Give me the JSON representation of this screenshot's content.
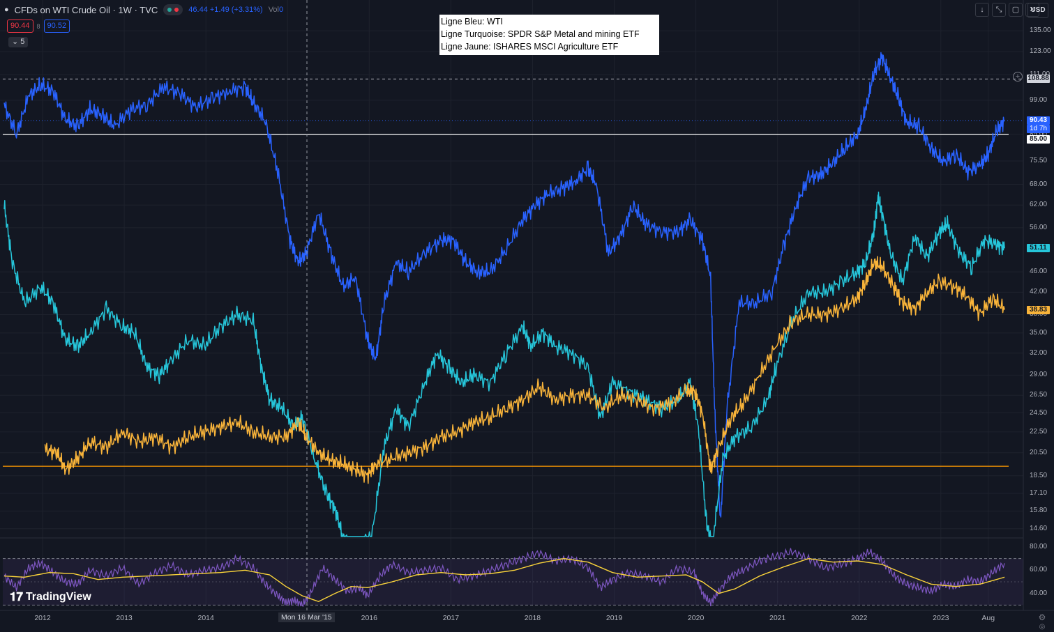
{
  "header": {
    "title": "CFDs on WTI Crude Oil · 1W · TVC",
    "stats": "46.44 +1.49 (+3.31%)",
    "vol_label": "Vol",
    "vol_value": "0",
    "price_left": "90.44",
    "price_mid": "8",
    "price_right": "90.52",
    "collapse_count": "5",
    "currency": "USD"
  },
  "toolbar_icons": [
    "arrow-down-icon",
    "collapse-icon",
    "restore-icon",
    "close-icon"
  ],
  "annotation": {
    "lines": [
      "Ligne Bleu: WTI",
      "Ligne Turquoise: SPDR S&P Metal and mining ETF",
      "Ligne Jaune: ISHARES MSCI Agriculture ETF"
    ]
  },
  "watermark": "TradingView",
  "crosshair_label": "Mon 16 Mar '15",
  "colors": {
    "background": "#131722",
    "wti": "#2962ff",
    "metal": "#26c6da",
    "agri": "#f9b43a",
    "rsi": "#7e57c2",
    "rsi_ma": "#f9d33a",
    "hline_orange": "#ff9800",
    "hline_white": "#ffffff"
  },
  "chart_data": [
    {
      "type": "line",
      "scale": "log",
      "x_ticks": [
        "2012",
        "2013",
        "2014",
        "2015",
        "2016",
        "2017",
        "2018",
        "2019",
        "2020",
        "2021",
        "2022",
        "2023",
        "Aug"
      ],
      "y_ticks": [
        "135.00",
        "123.00",
        "111.00",
        "99.00",
        "85.00",
        "75.50",
        "68.00",
        "62.00",
        "56.00",
        "46.00",
        "42.00",
        "38.00",
        "35.00",
        "32.00",
        "29.00",
        "26.50",
        "24.50",
        "22.50",
        "20.50",
        "18.50",
        "17.10",
        "15.80",
        "14.60"
      ],
      "ylim": [
        14.1,
        142
      ],
      "xlim": [
        2011.55,
        2023.85
      ],
      "horizontal_lines": [
        {
          "value": 108.88,
          "label": "108.88",
          "style": "dashed",
          "color": "#b2b5be"
        },
        {
          "value": 85.0,
          "label": "85.00",
          "style": "solid",
          "color": "#ffffff"
        },
        {
          "value": 19.3,
          "label": "",
          "style": "solid",
          "color": "#ff9800"
        }
      ],
      "last_values": [
        {
          "series": "WTI",
          "value": "90.43",
          "countdown": "1d 7h"
        },
        {
          "series": "Metal",
          "value": "51.11"
        },
        {
          "series": "Agri",
          "value": "38.83"
        }
      ],
      "series": [
        {
          "name": "WTI",
          "x": [
            2011.55,
            2011.7,
            2011.85,
            2012.0,
            2012.15,
            2012.3,
            2012.45,
            2012.6,
            2012.75,
            2012.9,
            2013.1,
            2013.3,
            2013.5,
            2013.7,
            2013.9,
            2014.1,
            2014.3,
            2014.5,
            2014.6,
            2014.75,
            2014.9,
            2015.05,
            2015.15,
            2015.25,
            2015.4,
            2015.55,
            2015.7,
            2015.85,
            2016.0,
            2016.1,
            2016.2,
            2016.35,
            2016.5,
            2016.7,
            2016.9,
            2017.05,
            2017.2,
            2017.35,
            2017.5,
            2017.7,
            2017.9,
            2018.05,
            2018.2,
            2018.4,
            2018.55,
            2018.7,
            2018.8,
            2018.95,
            2019.1,
            2019.25,
            2019.4,
            2019.6,
            2019.8,
            2019.95,
            2020.1,
            2020.2,
            2020.25,
            2020.32,
            2020.4,
            2020.55,
            2020.75,
            2020.95,
            2021.1,
            2021.25,
            2021.4,
            2021.55,
            2021.7,
            2021.85,
            2022.0,
            2022.1,
            2022.2,
            2022.3,
            2022.4,
            2022.5,
            2022.6,
            2022.75,
            2022.9,
            2023.05,
            2023.2,
            2023.35,
            2023.5,
            2023.6,
            2023.7,
            2023.8
          ],
          "values": [
            97,
            85,
            101,
            106,
            103,
            91,
            88,
            95,
            93,
            88,
            95,
            97,
            105,
            102,
            96,
            100,
            103,
            105,
            98,
            90,
            72,
            53,
            48,
            50,
            60,
            50,
            43,
            45,
            34,
            31,
            40,
            48,
            46,
            50,
            53,
            53,
            48,
            46,
            46,
            51,
            58,
            62,
            65,
            67,
            69,
            73,
            68,
            50,
            54,
            62,
            57,
            55,
            55,
            58,
            53,
            45,
            25,
            15,
            25,
            40,
            40,
            42,
            52,
            62,
            70,
            71,
            75,
            80,
            85,
            95,
            112,
            120,
            110,
            100,
            90,
            88,
            80,
            75,
            78,
            72,
            74,
            78,
            86,
            90.43
          ]
        },
        {
          "name": "Metal",
          "x": [
            2011.55,
            2011.65,
            2011.8,
            2012.0,
            2012.15,
            2012.3,
            2012.45,
            2012.6,
            2012.8,
            2013.0,
            2013.15,
            2013.3,
            2013.45,
            2013.6,
            2013.8,
            2014.0,
            2014.2,
            2014.4,
            2014.6,
            2014.7,
            2014.8,
            2014.95,
            2015.1,
            2015.2,
            2015.35,
            2015.5,
            2015.6,
            2015.7,
            2015.8,
            2015.92,
            2016.05,
            2016.2,
            2016.35,
            2016.5,
            2016.7,
            2016.85,
            2017.0,
            2017.15,
            2017.3,
            2017.5,
            2017.7,
            2017.9,
            2018.0,
            2018.15,
            2018.3,
            2018.5,
            2018.7,
            2018.85,
            2019.0,
            2019.2,
            2019.4,
            2019.6,
            2019.8,
            2019.95,
            2020.05,
            2020.15,
            2020.22,
            2020.35,
            2020.5,
            2020.7,
            2020.9,
            2021.0,
            2021.2,
            2021.4,
            2021.6,
            2021.8,
            2022.0,
            2022.1,
            2022.2,
            2022.25,
            2022.3,
            2022.4,
            2022.55,
            2022.7,
            2022.85,
            2023.0,
            2023.1,
            2023.25,
            2023.4,
            2023.55,
            2023.7,
            2023.8
          ],
          "values": [
            62,
            48,
            40,
            43,
            40,
            34,
            33,
            35,
            39,
            36,
            35,
            30,
            29,
            31,
            34,
            33,
            36,
            38,
            37,
            30,
            26,
            25,
            23,
            24,
            20,
            17,
            16,
            14,
            13.5,
            13.5,
            14,
            21,
            25,
            23,
            28,
            32,
            30,
            28,
            29,
            28,
            32,
            36,
            33,
            35,
            33,
            32,
            30,
            24,
            28,
            27,
            26,
            25,
            26,
            28,
            23,
            15,
            13.5,
            20,
            22,
            23,
            26,
            30,
            37,
            42,
            42,
            44,
            46,
            48,
            55,
            64,
            60,
            50,
            44,
            54,
            49,
            55,
            57,
            50,
            47,
            53,
            52,
            51.11
          ]
        },
        {
          "name": "Agri",
          "x": [
            2012.05,
            2012.2,
            2012.3,
            2012.45,
            2012.6,
            2012.8,
            2013.0,
            2013.2,
            2013.4,
            2013.6,
            2013.8,
            2014.0,
            2014.2,
            2014.4,
            2014.6,
            2014.8,
            2015.0,
            2015.15,
            2015.25,
            2015.4,
            2015.55,
            2015.7,
            2015.85,
            2016.0,
            2016.1,
            2016.3,
            2016.5,
            2016.7,
            2016.9,
            2017.1,
            2017.3,
            2017.5,
            2017.7,
            2017.9,
            2018.1,
            2018.3,
            2018.5,
            2018.7,
            2018.9,
            2019.1,
            2019.3,
            2019.5,
            2019.7,
            2019.9,
            2020.0,
            2020.1,
            2020.2,
            2020.3,
            2020.45,
            2020.6,
            2020.8,
            2021.0,
            2021.2,
            2021.4,
            2021.6,
            2021.8,
            2022.0,
            2022.1,
            2022.2,
            2022.3,
            2022.45,
            2022.55,
            2022.7,
            2022.85,
            2023.0,
            2023.2,
            2023.35,
            2023.5,
            2023.65,
            2023.8
          ],
          "values": [
            20.8,
            20.5,
            19.0,
            20.0,
            21.5,
            21.0,
            22.5,
            21.5,
            22.0,
            21.0,
            22.0,
            22.5,
            23.0,
            23.5,
            22.5,
            22.0,
            22.0,
            23.5,
            22.0,
            20.5,
            19.8,
            19.5,
            19.0,
            18.5,
            19.5,
            20.0,
            20.5,
            21.0,
            22.0,
            22.5,
            23.5,
            24.0,
            25.0,
            26.0,
            27.5,
            26.0,
            26.5,
            26.5,
            25.0,
            26.5,
            26.0,
            25.0,
            25.5,
            27.0,
            27.0,
            24.5,
            19.0,
            21.0,
            24.0,
            25.5,
            29.0,
            33.0,
            37.0,
            38.0,
            38.0,
            39.0,
            41.0,
            44.0,
            48.0,
            47.0,
            43.0,
            40.0,
            39.0,
            42.0,
            44.0,
            43.0,
            41.0,
            38.0,
            41.0,
            38.83
          ]
        }
      ]
    },
    {
      "type": "line",
      "title": "",
      "y_ticks": [
        "80.00",
        "60.00",
        "40.00"
      ],
      "ylim": [
        29,
        86
      ],
      "bands": [
        30,
        70
      ],
      "series": [
        {
          "name": "",
          "x": [
            2011.55,
            2011.7,
            2011.85,
            2012.0,
            2012.15,
            2012.3,
            2012.45,
            2012.6,
            2012.8,
            2013.0,
            2013.2,
            2013.4,
            2013.6,
            2013.8,
            2014.0,
            2014.2,
            2014.4,
            2014.6,
            2014.75,
            2014.9,
            2015.0,
            2015.1,
            2015.2,
            2015.3,
            2015.45,
            2015.6,
            2015.75,
            2015.9,
            2016.0,
            2016.15,
            2016.3,
            2016.5,
            2016.7,
            2016.9,
            2017.1,
            2017.3,
            2017.5,
            2017.7,
            2017.9,
            2018.1,
            2018.3,
            2018.5,
            2018.7,
            2018.85,
            2019.0,
            2019.2,
            2019.4,
            2019.6,
            2019.8,
            2020.0,
            2020.1,
            2020.2,
            2020.3,
            2020.45,
            2020.6,
            2020.8,
            2021.0,
            2021.2,
            2021.4,
            2021.6,
            2021.8,
            2022.0,
            2022.15,
            2022.3,
            2022.45,
            2022.6,
            2022.75,
            2022.9,
            2023.05,
            2023.2,
            2023.35,
            2023.5,
            2023.65,
            2023.8
          ],
          "values": [
            55,
            45,
            62,
            66,
            58,
            50,
            48,
            60,
            55,
            62,
            48,
            58,
            64,
            56,
            60,
            62,
            70,
            62,
            48,
            38,
            32,
            34,
            30,
            40,
            62,
            52,
            42,
            45,
            38,
            55,
            65,
            58,
            60,
            62,
            52,
            55,
            60,
            65,
            70,
            75,
            68,
            70,
            62,
            45,
            52,
            58,
            55,
            50,
            62,
            58,
            40,
            32,
            42,
            55,
            60,
            68,
            72,
            76,
            70,
            62,
            65,
            70,
            76,
            68,
            55,
            48,
            45,
            42,
            48,
            46,
            52,
            50,
            58,
            66
          ]
        },
        {
          "name": "",
          "x": [
            2011.55,
            2011.8,
            2012.1,
            2012.4,
            2012.7,
            2013.0,
            2013.3,
            2013.6,
            2013.9,
            2014.2,
            2014.5,
            2014.8,
            2015.0,
            2015.2,
            2015.4,
            2015.6,
            2015.8,
            2016.0,
            2016.3,
            2016.6,
            2016.9,
            2017.2,
            2017.5,
            2017.8,
            2018.1,
            2018.4,
            2018.7,
            2019.0,
            2019.3,
            2019.6,
            2019.9,
            2020.1,
            2020.3,
            2020.5,
            2020.8,
            2021.1,
            2021.4,
            2021.7,
            2022.0,
            2022.3,
            2022.6,
            2022.9,
            2023.2,
            2023.5,
            2023.8
          ],
          "values": [
            55,
            54,
            58,
            57,
            52,
            54,
            55,
            56,
            57,
            58,
            60,
            56,
            46,
            38,
            33,
            40,
            46,
            45,
            50,
            56,
            58,
            56,
            57,
            60,
            66,
            70,
            67,
            58,
            54,
            55,
            56,
            50,
            40,
            44,
            55,
            63,
            70,
            67,
            68,
            65,
            56,
            48,
            46,
            48,
            54
          ]
        }
      ]
    }
  ]
}
